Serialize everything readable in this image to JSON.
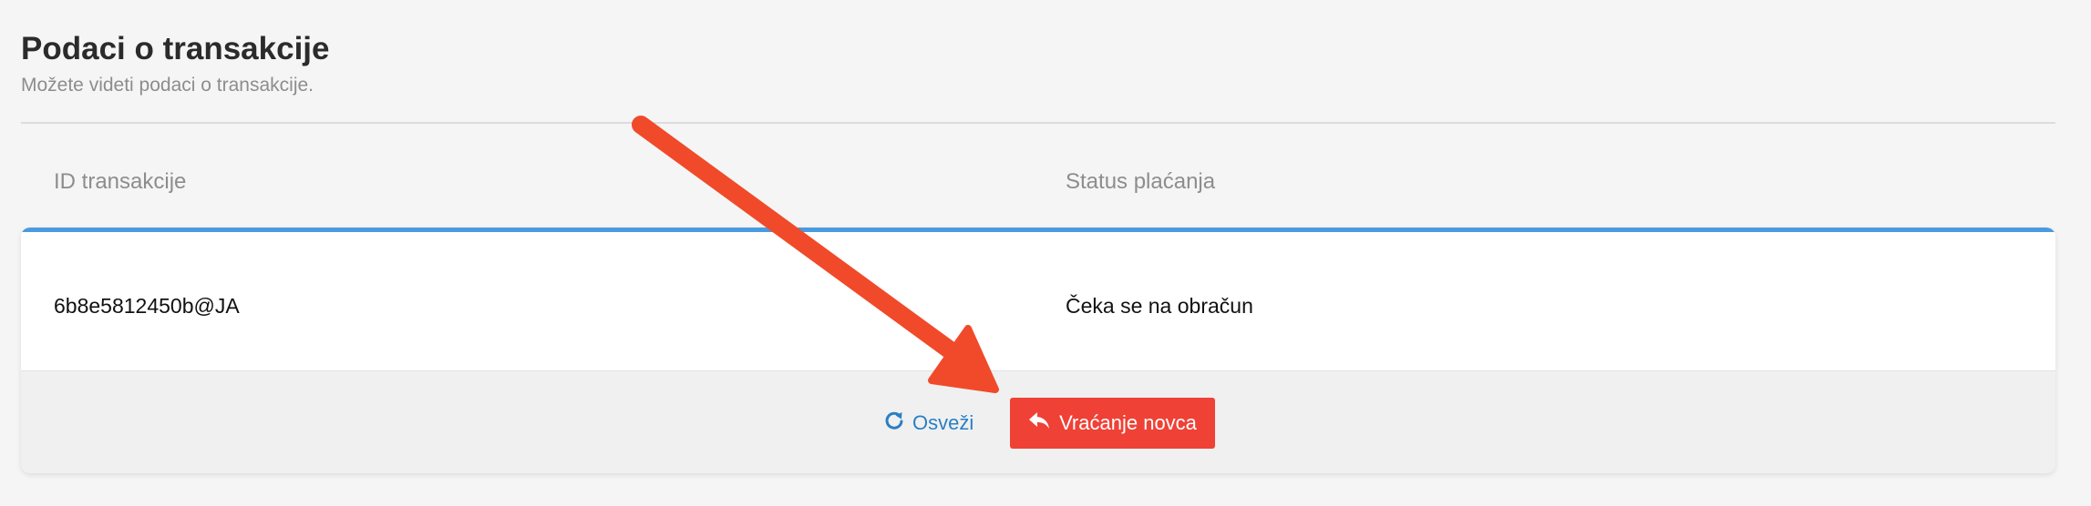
{
  "header": {
    "title": "Podaci o transakcije",
    "subtitle": "Možete videti podaci o transakcije."
  },
  "table": {
    "columns": [
      "ID transakcije",
      "Status plaćanja"
    ],
    "rows": [
      [
        "6b8e5812450b@JA",
        "Čeka se na obračun"
      ]
    ]
  },
  "actions": {
    "refresh_label": "Osveži",
    "refund_label": "Vraćanje novca"
  },
  "colors": {
    "accent": "#4a9ae0",
    "refresh": "#2a7fc4",
    "refund": "#ef4136",
    "annotation": "#f04a2a"
  },
  "icons": {
    "refresh": "refresh-icon",
    "refund": "reply-arrow-icon",
    "annotation": "annotation-arrow"
  }
}
